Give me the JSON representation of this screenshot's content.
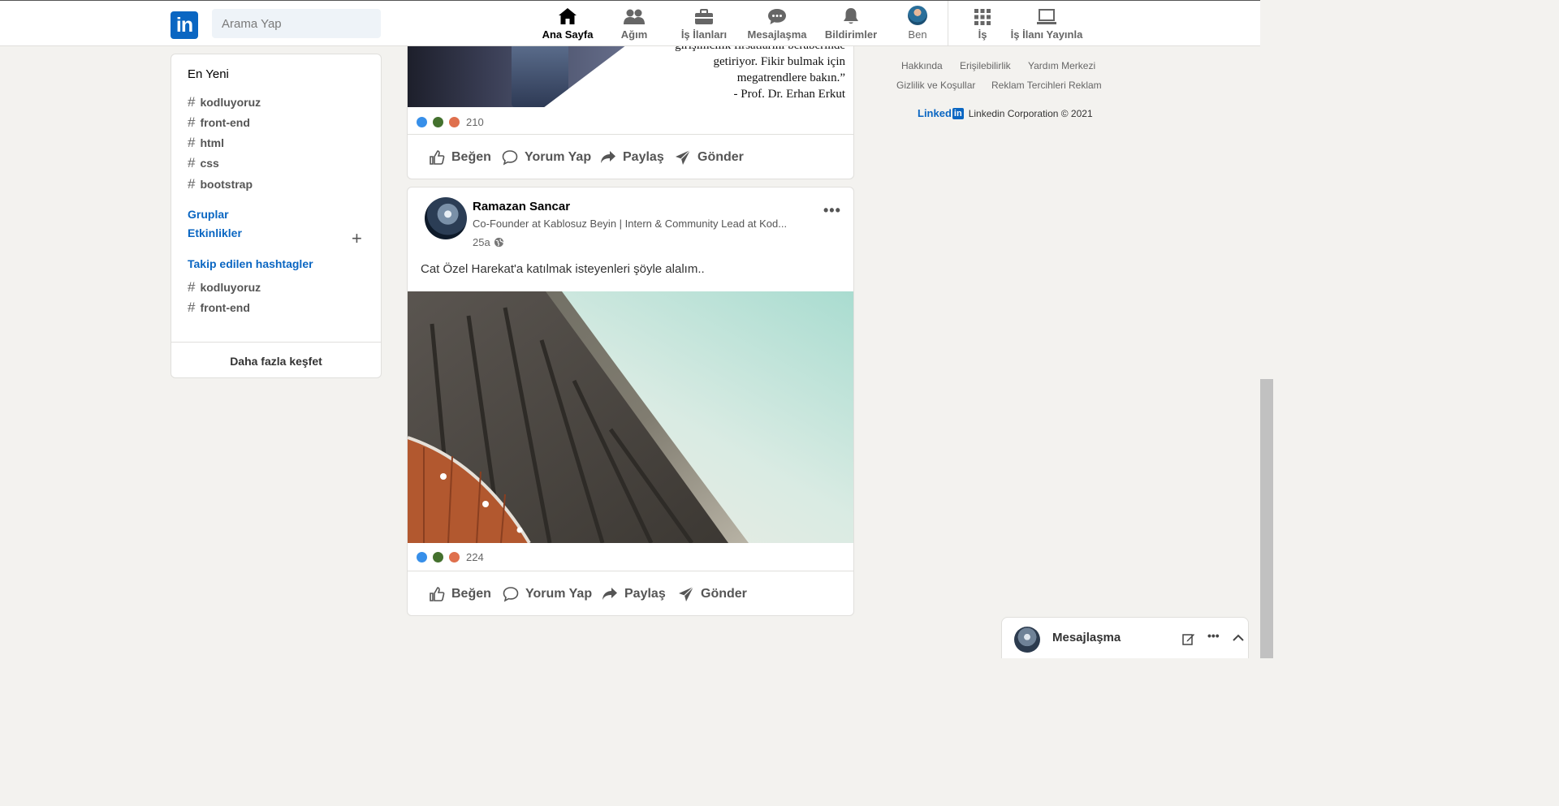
{
  "nav": {
    "logo": "in",
    "search_placeholder": "Arama Yap",
    "items": [
      {
        "label": "Ana Sayfa",
        "icon": "home-icon",
        "active": true
      },
      {
        "label": "Ağım",
        "icon": "network-icon",
        "active": false
      },
      {
        "label": "İş İlanları",
        "icon": "briefcase-icon",
        "active": false
      },
      {
        "label": "Mesajlaşma",
        "icon": "chat-icon",
        "active": false
      },
      {
        "label": "Bildirimler",
        "icon": "bell-icon",
        "active": false
      },
      {
        "label": "Ben",
        "icon": "avatar",
        "active": false
      },
      {
        "label": "İş",
        "icon": "grid-icon",
        "active": false
      },
      {
        "label": "İş İlanı Yayınla",
        "icon": "laptop-icon",
        "active": false
      }
    ]
  },
  "sidebar": {
    "recent_title": "En Yeni",
    "recent_tags": [
      "kodluyoruz",
      "front-end",
      "html",
      "css",
      "bootstrap"
    ],
    "groups_label": "Gruplar",
    "events_label": "Etkinlikler",
    "add_symbol": "+",
    "followed_title": "Takip edilen hashtagler",
    "followed_tags": [
      "kodluyoruz",
      "front-end"
    ],
    "discover_more": "Daha fazla keşfet",
    "hash": "#"
  },
  "post1": {
    "quote_lines": [
      "girişimcilik fırsatlarını beraberinde",
      "getiriyor. Fikir bulmak için",
      "megatrendlere bakın.”",
      "- Prof. Dr. Erhan Erkut"
    ],
    "reaction_count": "210"
  },
  "post2": {
    "author": "Ramazan Sancar",
    "headline": "Co-Founder at Kablosuz Beyin | Intern & Community Lead at Kod...",
    "time": "25a",
    "text": "Cat Özel Harekat'a katılmak isteyenleri şöyle alalım..",
    "more": "•••",
    "reaction_count": "224"
  },
  "actions": {
    "like": "Beğen",
    "comment": "Yorum Yap",
    "share": "Paylaş",
    "send": "Gönder"
  },
  "footer": {
    "links_row1": [
      "Hakkında",
      "Erişilebilirlik",
      "Yardım Merkezi"
    ],
    "links_row2": [
      "Gizlilik ve Koşullar",
      "Reklam Tercihleri",
      "Reklam"
    ],
    "brand": "Linked",
    "brand_in": "in",
    "copyright": "Linkedin Corporation © 2021"
  },
  "messaging": {
    "label": "Mesajlaşma",
    "more": "•••"
  },
  "colors": {
    "accent": "#0a66c2",
    "background": "#f3f2ef",
    "like": "#378fe9",
    "celebrate": "#44712e",
    "love": "#df704d"
  }
}
